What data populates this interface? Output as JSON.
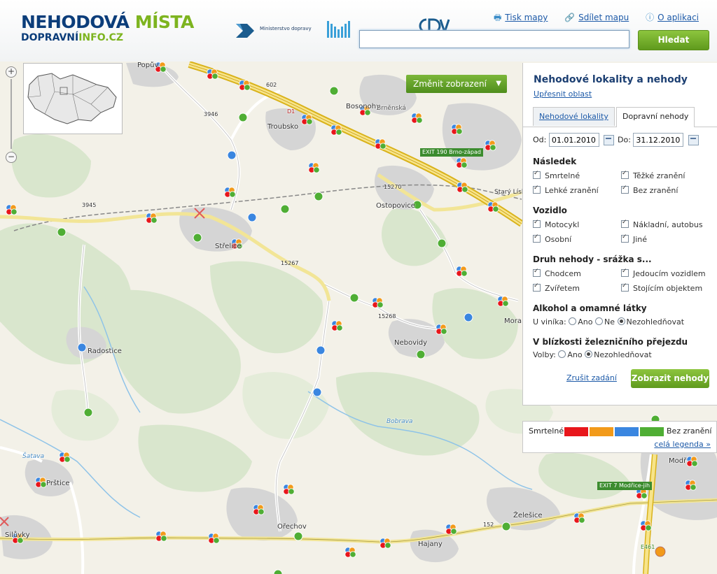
{
  "header": {
    "logo_line1_a": "NEHODOVÁ",
    "logo_line1_b": "MÍSTA",
    "logo_line2_a": "DOPRAVNÍ",
    "logo_line2_b": "INFO.CZ",
    "partner1_text": "Ministerstvo dopravy",
    "links": {
      "print": "Tisk mapy",
      "share": "Sdílet mapu",
      "about": "O aplikaci"
    },
    "search_value": "",
    "search_button": "Hledat"
  },
  "map": {
    "change_view_label": "Změnit zobrazení",
    "places": {
      "popuvky": "Popův",
      "troubsko": "Troubsko",
      "bosonohy": "Bosonohy",
      "brazska": "Brněnská",
      "stary_liskovec": "Starý Lískovec",
      "ostopovice": "Ostopovice",
      "strelice": "Střelice",
      "radostice": "Radostice",
      "nebovidy": "Nebovidy",
      "moravany": "Mora",
      "prstice": "Prštice",
      "silurky": "Silůvky",
      "orechov": "Ořechov",
      "hajany": "Hajany",
      "zelesice": "Želešice",
      "modrice": "Modř",
      "bobrava": "Bobrava",
      "svratka": "Šatava"
    },
    "road_numbers": {
      "r3945": "3945",
      "r3946": "3946",
      "r602": "602",
      "r15267": "15267",
      "r152": "152",
      "r15270": "15270",
      "r15268": "15268",
      "d1": "D1",
      "e461": "E461"
    },
    "exit_labels": {
      "exit190": "EXIT 190 Brno-západ",
      "exit7": "EXIT 7 Modřice-jih"
    }
  },
  "panel": {
    "title": "Nehodové lokality a nehody",
    "refine_link": "Upřesnit oblast",
    "tabs": {
      "localities": "Nehodové lokality",
      "accidents": "Dopravní nehody"
    },
    "date_from_label": "Od:",
    "date_from": "01.01.2010",
    "date_to_label": "Do:",
    "date_to": "31.12.2010",
    "sections": {
      "consequence": {
        "title": "Následek",
        "items": [
          "Smrtelné",
          "Těžké zranění",
          "Lehké zranění",
          "Bez zranění"
        ]
      },
      "vehicle": {
        "title": "Vozidlo",
        "items": [
          "Motocykl",
          "Nákladní, autobus",
          "Osobní",
          "Jiné"
        ]
      },
      "type": {
        "title": "Druh nehody - srážka s...",
        "items": [
          "Chodcem",
          "Jedoucím vozidlem",
          "Zvířetem",
          "Stojícím objektem"
        ]
      },
      "alcohol": {
        "title": "Alkohol a omamné látky",
        "label": "U viníka:",
        "options": [
          "Ano",
          "Ne",
          "Nezohledňovat"
        ]
      },
      "railway": {
        "title": "V blízkosti železničního přejezdu",
        "label": "Volby:",
        "options": [
          "Ano",
          "Nezohledňovat"
        ]
      }
    },
    "reset_link": "Zrušit zadání",
    "show_button": "Zobrazit nehody"
  },
  "legend": {
    "fatal": "Smrtelné",
    "none": "Bez zranění",
    "full": "celá legenda »",
    "colors": [
      "#e8161b",
      "#f29a1a",
      "#3a86e0",
      "#4fae34"
    ]
  },
  "colors": {
    "brand_blue": "#0b3d7a",
    "brand_green": "#7db41f",
    "link_blue": "#1d5aa8",
    "button_green": "#6aa829"
  }
}
